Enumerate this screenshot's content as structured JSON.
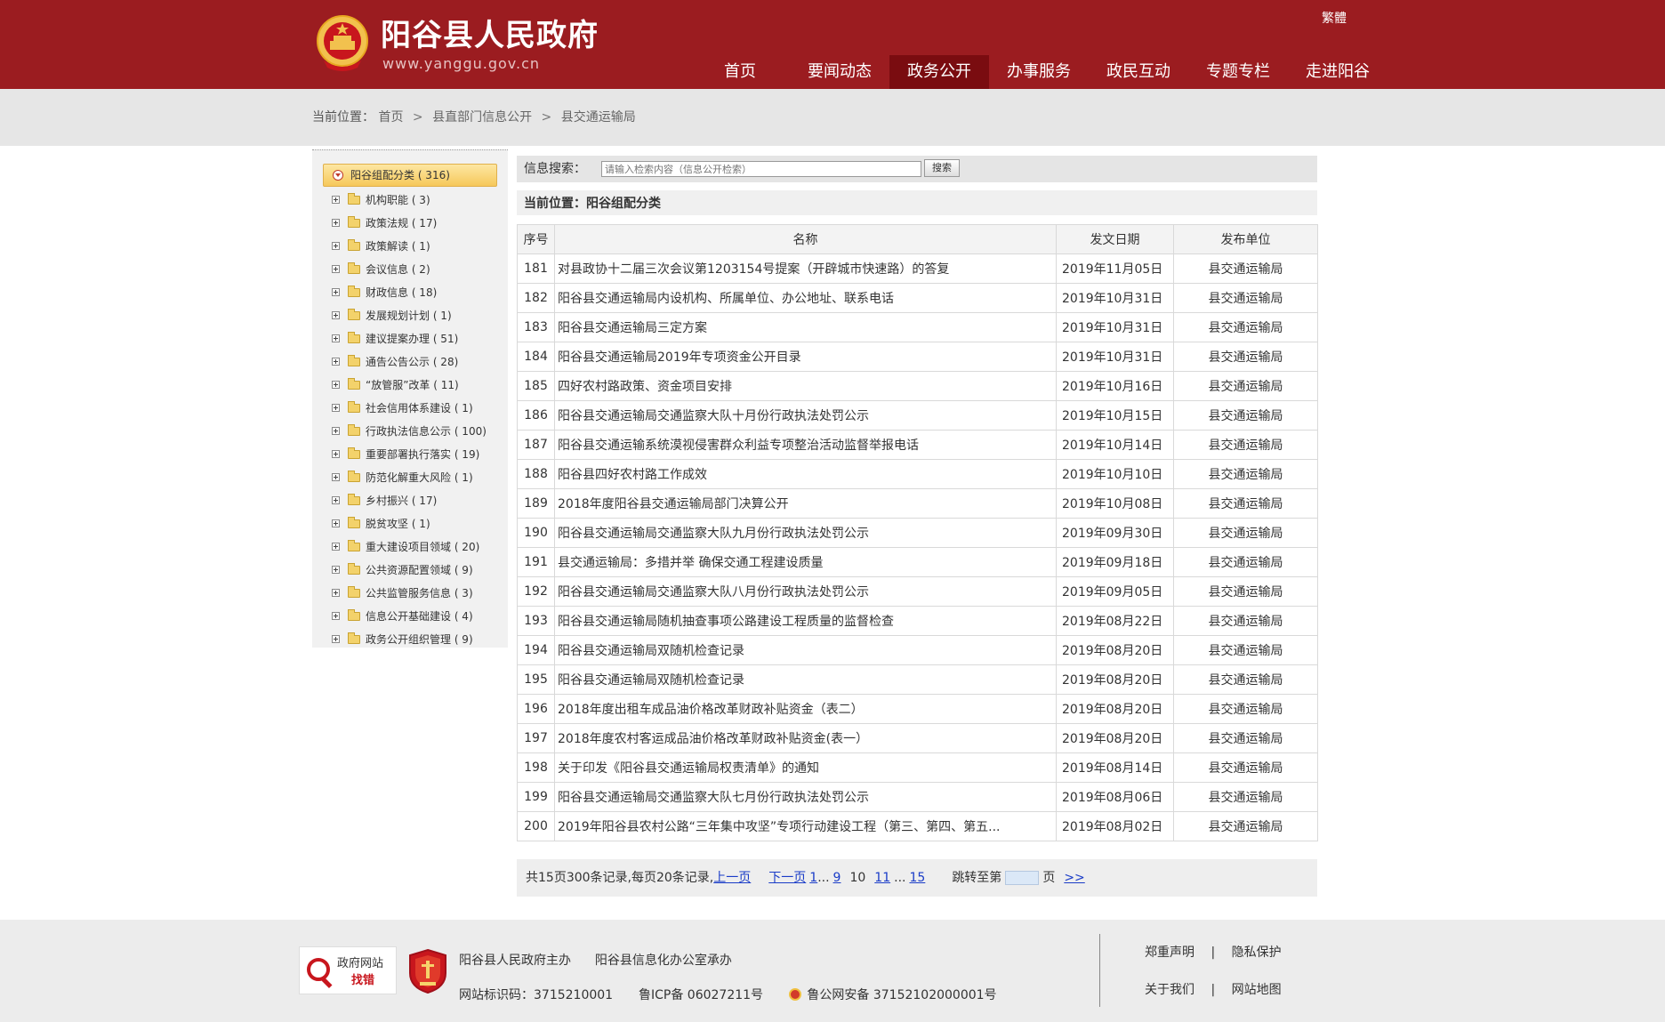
{
  "header": {
    "site_title": "阳谷县人民政府",
    "site_url": "www.yanggu.gov.cn",
    "traditional_link": "繁體",
    "nav": [
      {
        "label": "首页",
        "active": false
      },
      {
        "label": "要闻动态",
        "active": false
      },
      {
        "label": "政务公开",
        "active": true
      },
      {
        "label": "办事服务",
        "active": false
      },
      {
        "label": "政民互动",
        "active": false
      },
      {
        "label": "专题专栏",
        "active": false
      },
      {
        "label": "走进阳谷",
        "active": false
      }
    ]
  },
  "breadcrumb": {
    "prefix": "当前位置：",
    "items": [
      "首页",
      "县直部门信息公开",
      "县交通运输局"
    ],
    "separator": ">"
  },
  "sidebar": {
    "root": "阳谷组配分类 ( 316)",
    "items": [
      "机构职能 ( 3)",
      "政策法规 ( 17)",
      "政策解读 ( 1)",
      "会议信息 ( 2)",
      "财政信息 ( 18)",
      "发展规划计划 ( 1)",
      "建议提案办理 ( 51)",
      "通告公告公示 ( 28)",
      "“放管服”改革 ( 11)",
      "社会信用体系建设 ( 1)",
      "行政执法信息公示 ( 100)",
      "重要部署执行落实 ( 19)",
      "防范化解重大风险 ( 1)",
      "乡村振兴 ( 17)",
      "脱贫攻坚 ( 1)",
      "重大建设项目领域 ( 20)",
      "公共资源配置领域 ( 9)",
      "公共监管服务信息 ( 3)",
      "信息公开基础建设 ( 4)",
      "政务公开组织管理 ( 9)"
    ]
  },
  "search": {
    "label": "信息搜索：",
    "placeholder": "请输入检索内容（信息公开检索）",
    "button": "搜索"
  },
  "location_bar": "当前位置：阳谷组配分类",
  "table": {
    "headers": [
      "序号",
      "名称",
      "发文日期",
      "发布单位"
    ],
    "rows": [
      {
        "no": "181",
        "title": "对县政协十二届三次会议第1203154号提案（开辟城市快速路）的答复",
        "date": "2019年11月05日",
        "dept": "县交通运输局"
      },
      {
        "no": "182",
        "title": "阳谷县交通运输局内设机构、所属单位、办公地址、联系电话",
        "date": "2019年10月31日",
        "dept": "县交通运输局"
      },
      {
        "no": "183",
        "title": "阳谷县交通运输局三定方案",
        "date": "2019年10月31日",
        "dept": "县交通运输局"
      },
      {
        "no": "184",
        "title": "阳谷县交通运输局2019年专项资金公开目录",
        "date": "2019年10月31日",
        "dept": "县交通运输局"
      },
      {
        "no": "185",
        "title": "四好农村路政策、资金项目安排",
        "date": "2019年10月16日",
        "dept": "县交通运输局"
      },
      {
        "no": "186",
        "title": "阳谷县交通运输局交通监察大队十月份行政执法处罚公示",
        "date": "2019年10月15日",
        "dept": "县交通运输局"
      },
      {
        "no": "187",
        "title": "阳谷县交通运输系统漠视侵害群众利益专项整治活动监督举报电话",
        "date": "2019年10月14日",
        "dept": "县交通运输局"
      },
      {
        "no": "188",
        "title": "阳谷县四好农村路工作成效",
        "date": "2019年10月10日",
        "dept": "县交通运输局"
      },
      {
        "no": "189",
        "title": "2018年度阳谷县交通运输局部门决算公开",
        "date": "2019年10月08日",
        "dept": "县交通运输局"
      },
      {
        "no": "190",
        "title": "阳谷县交通运输局交通监察大队九月份行政执法处罚公示",
        "date": "2019年09月30日",
        "dept": "县交通运输局"
      },
      {
        "no": "191",
        "title": "县交通运输局：多措并举 确保交通工程建设质量",
        "date": "2019年09月18日",
        "dept": "县交通运输局"
      },
      {
        "no": "192",
        "title": "阳谷县交通运输局交通监察大队八月份行政执法处罚公示",
        "date": "2019年09月05日",
        "dept": "县交通运输局"
      },
      {
        "no": "193",
        "title": "阳谷县交通运输局随机抽查事项公路建设工程质量的监督检查",
        "date": "2019年08月22日",
        "dept": "县交通运输局"
      },
      {
        "no": "194",
        "title": "阳谷县交通运输局双随机检查记录",
        "date": "2019年08月20日",
        "dept": "县交通运输局"
      },
      {
        "no": "195",
        "title": "阳谷县交通运输局双随机检查记录",
        "date": "2019年08月20日",
        "dept": "县交通运输局"
      },
      {
        "no": "196",
        "title": "2018年度出租车成品油价格改革财政补贴资金（表二）",
        "date": "2019年08月20日",
        "dept": "县交通运输局"
      },
      {
        "no": "197",
        "title": "2018年度农村客运成品油价格改革财政补贴资金(表一）",
        "date": "2019年08月20日",
        "dept": "县交通运输局"
      },
      {
        "no": "198",
        "title": "关于印发《阳谷县交通运输局权责清单》的通知",
        "date": "2019年08月14日",
        "dept": "县交通运输局"
      },
      {
        "no": "199",
        "title": "阳谷县交通运输局交通监察大队七月份行政执法处罚公示",
        "date": "2019年08月06日",
        "dept": "县交通运输局"
      },
      {
        "no": "200",
        "title": "2019年阳谷县农村公路“三年集中攻坚”专项行动建设工程（第三、第四、第五...",
        "date": "2019年08月02日",
        "dept": "县交通运输局"
      }
    ]
  },
  "pager": {
    "summary": "共15页300条记录,每页20条记录,",
    "prev": "上一页",
    "next": "下一页",
    "first": "1",
    "ellipsis1": "...",
    "p9": "9",
    "current": "10",
    "p11": "11",
    "ellipsis2": "...",
    "last": "15",
    "jump_prefix": "跳转至第",
    "jump_suffix": "页",
    "go": ">>"
  },
  "footer": {
    "find_error_title": "政府网站",
    "find_error_sub": "找错",
    "sponsor": "阳谷县人民政府主办",
    "organizer": "阳谷县信息化办公室承办",
    "site_id": "网站标识码：3715210001",
    "icp": "鲁ICP备 06027211号",
    "police": "鲁公网安备 37152102000001号",
    "links_row1": [
      "郑重声明",
      "隐私保护"
    ],
    "links_row2": [
      "关于我们",
      "网站地图"
    ],
    "link_separator": "|"
  }
}
